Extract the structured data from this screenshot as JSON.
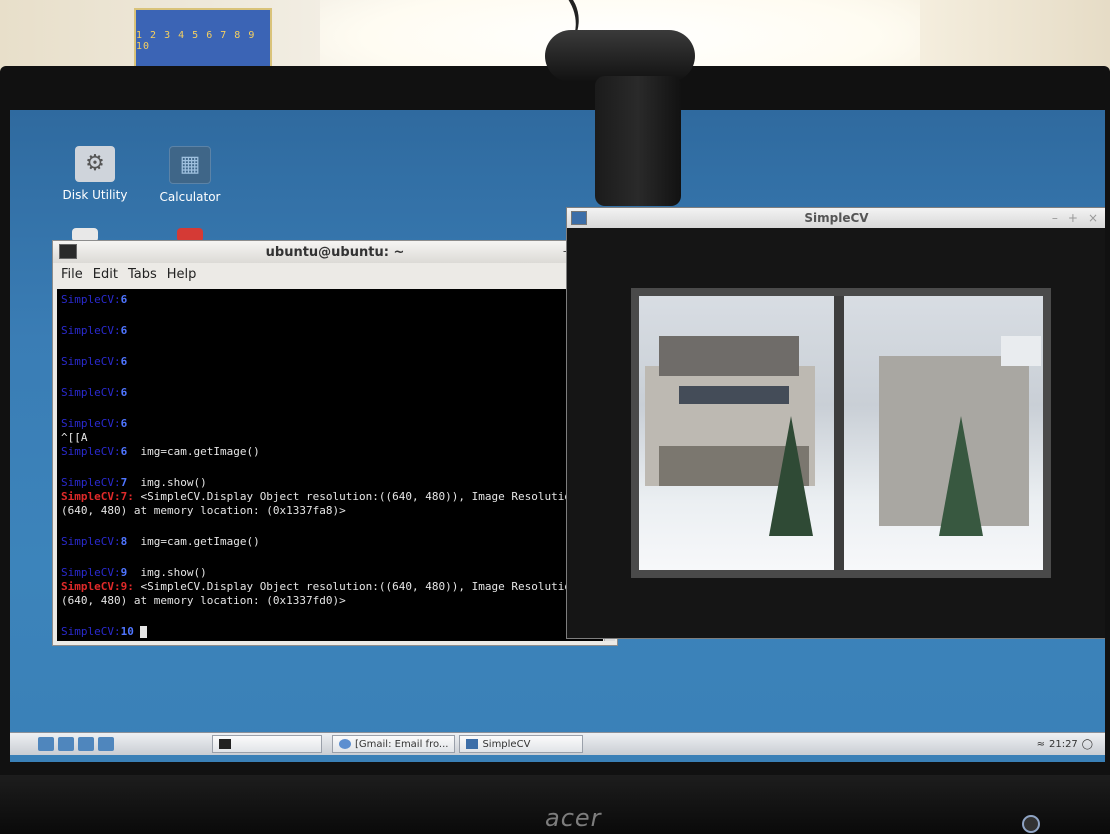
{
  "desktop": {
    "icons": [
      {
        "label": "Disk Utility"
      },
      {
        "label": "Calculator"
      }
    ]
  },
  "terminal": {
    "title": "ubuntu@ubuntu: ~",
    "menu": [
      "File",
      "Edit",
      "Tabs",
      "Help"
    ],
    "controls": [
      "–",
      "+",
      "×"
    ],
    "lines": [
      {
        "kind": "prompt",
        "num": "6",
        "text": ""
      },
      {
        "kind": "prompt",
        "num": "6",
        "text": ""
      },
      {
        "kind": "prompt",
        "num": "6",
        "text": ""
      },
      {
        "kind": "prompt",
        "num": "6",
        "text": ""
      },
      {
        "kind": "prompt",
        "num": "6",
        "text": ""
      },
      {
        "kind": "raw",
        "text": "^[[A"
      },
      {
        "kind": "prompt",
        "num": "6",
        "text": "img=cam.getImage()"
      },
      {
        "kind": "prompt",
        "num": "7",
        "text": "img.show()"
      },
      {
        "kind": "out",
        "prefix": "SimpleCV:7:",
        "text": "<SimpleCV.Display Object resolution:((640, 480)), Image Resolution:"
      },
      {
        "kind": "raw",
        "text": "(640, 480) at memory location: (0x1337fa8)>"
      },
      {
        "kind": "prompt",
        "num": "8",
        "text": "img=cam.getImage()"
      },
      {
        "kind": "prompt",
        "num": "9",
        "text": "img.show()"
      },
      {
        "kind": "out",
        "prefix": "SimpleCV:9:",
        "text": "<SimpleCV.Display Object resolution:((640, 480)), Image Resolution:"
      },
      {
        "kind": "raw",
        "text": "(640, 480) at memory location: (0x1337fd0)>"
      },
      {
        "kind": "prompt",
        "num": "10",
        "text": ""
      }
    ]
  },
  "simplecv": {
    "title": "SimpleCV",
    "controls": [
      "–",
      "+",
      "×"
    ]
  },
  "taskbar": {
    "tasks": [
      {
        "label": "[Gmail: Email fro..."
      },
      {
        "label": "SimpleCV"
      }
    ],
    "clock": "21:27"
  },
  "monitor": {
    "brand": "acer"
  }
}
